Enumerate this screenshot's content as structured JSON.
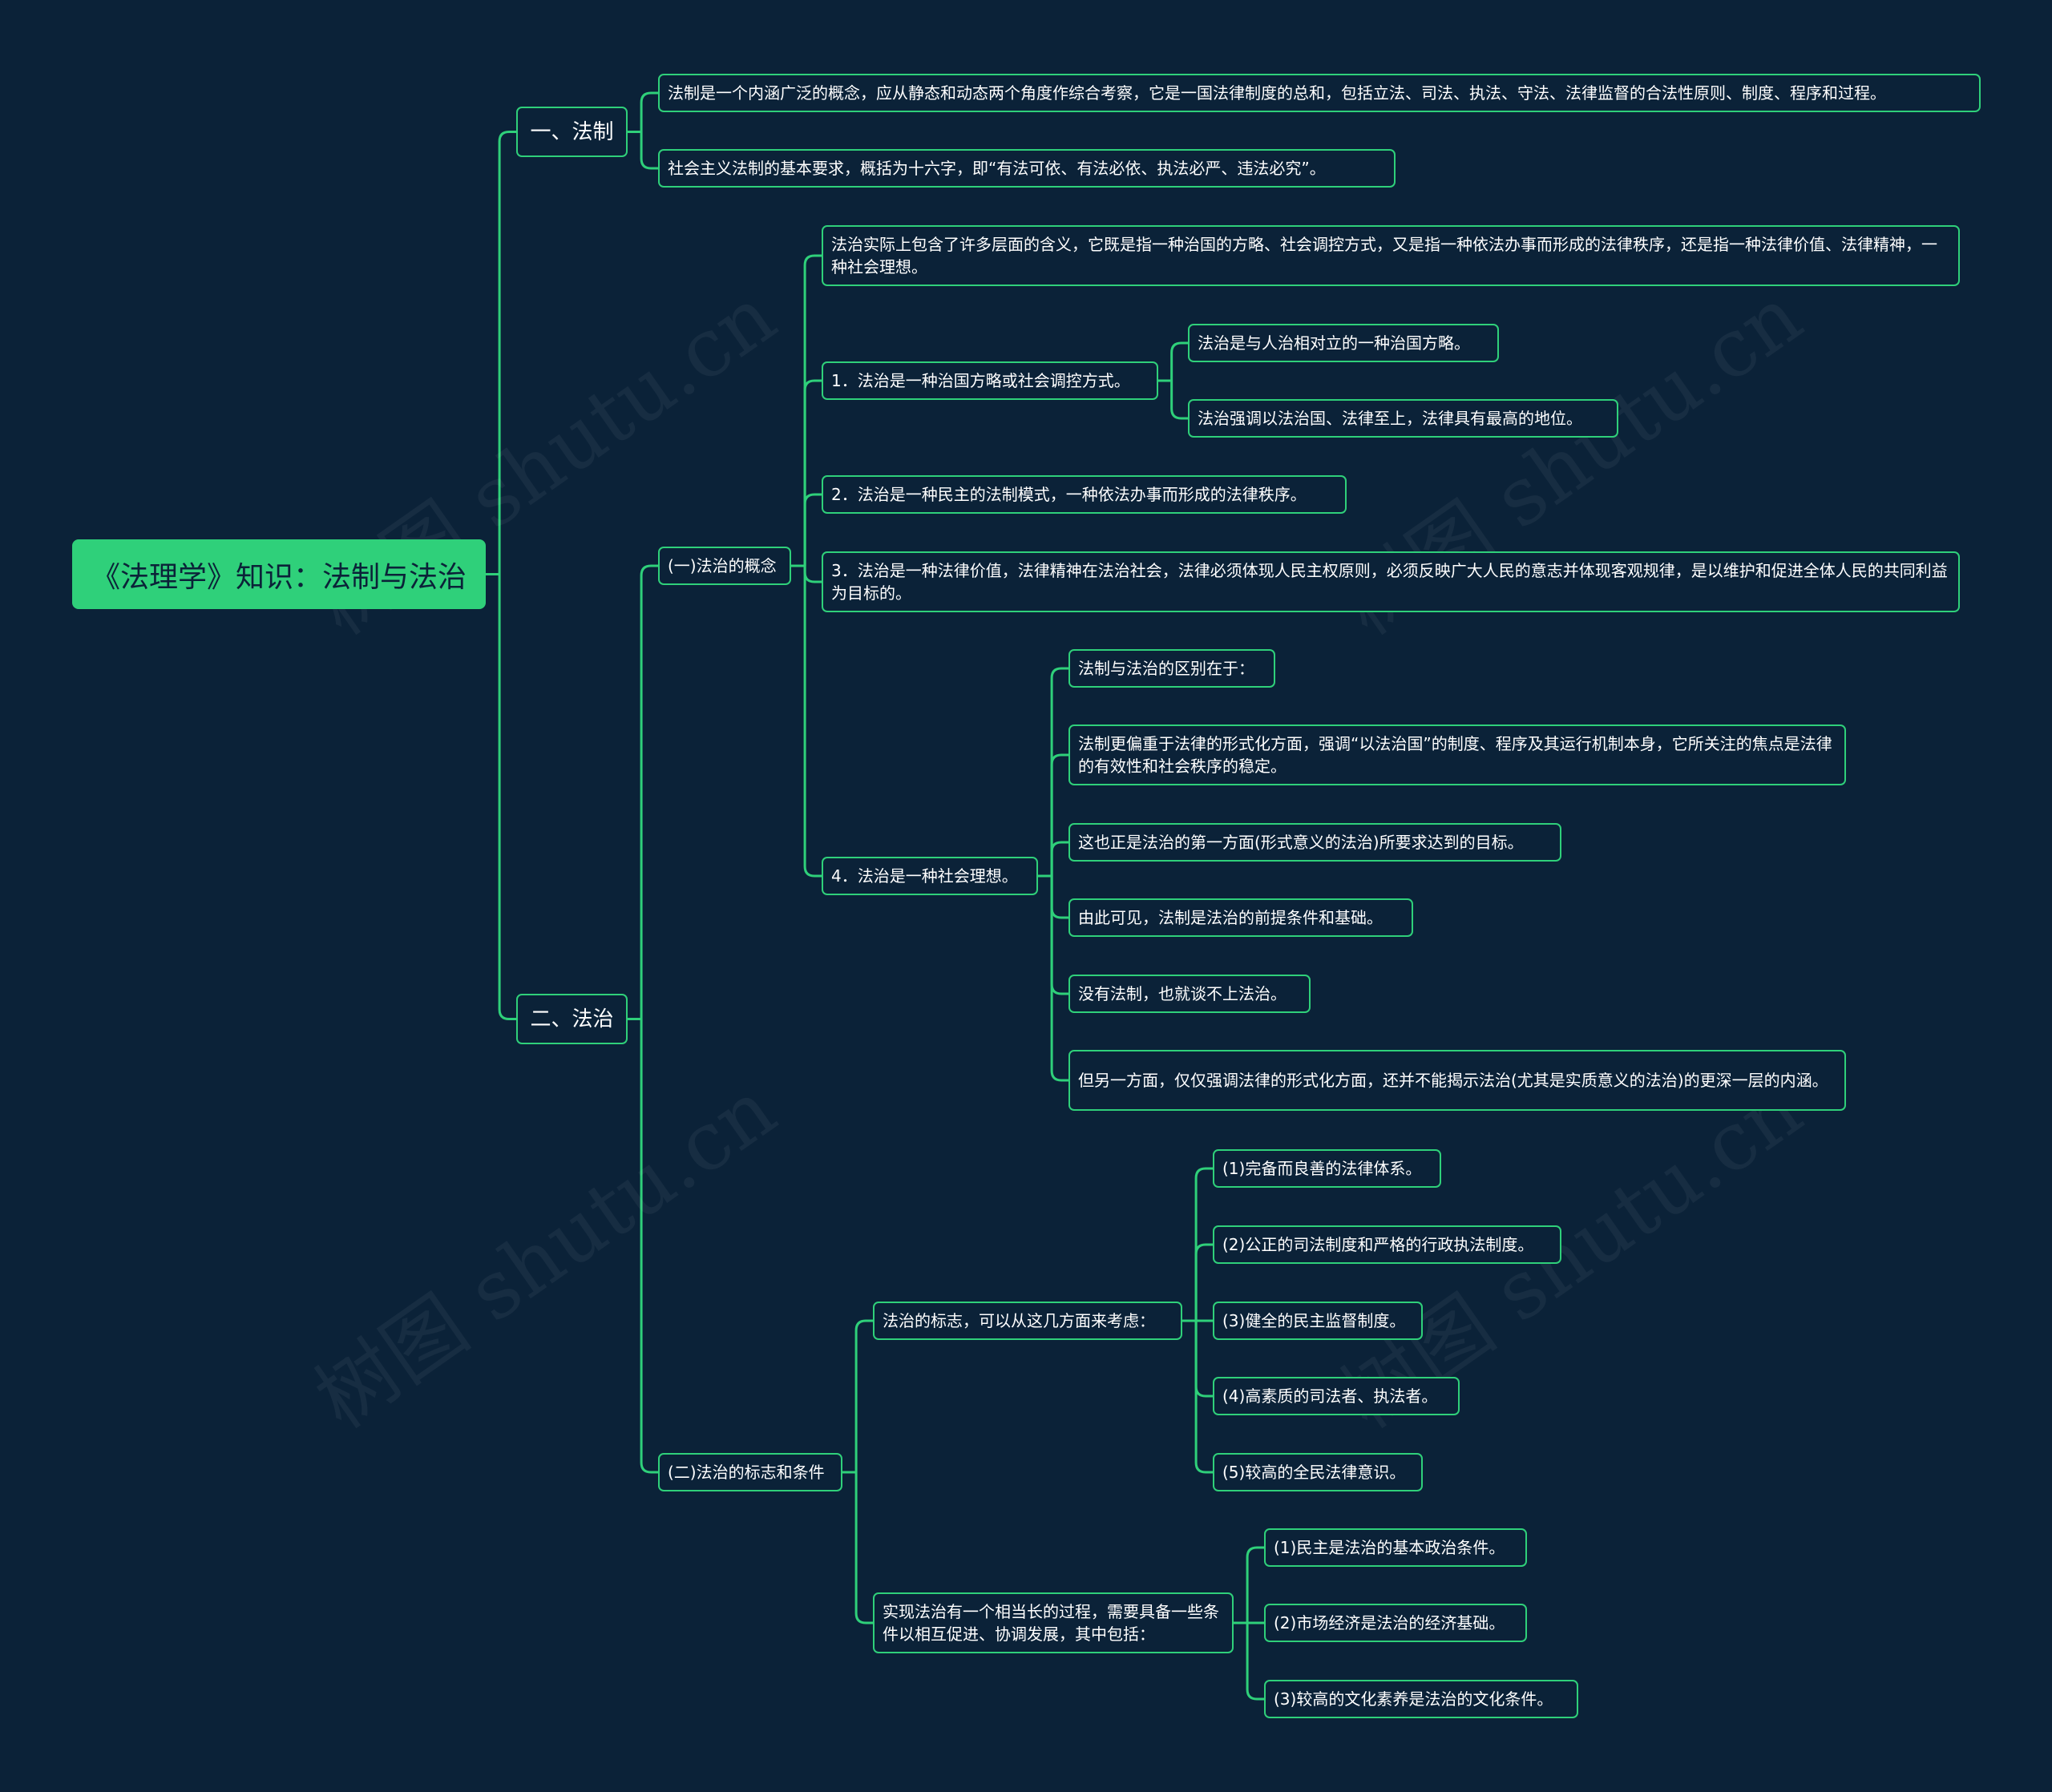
{
  "diagram": {
    "root": "《法理学》知识：法制与法治",
    "watermark": "树图 shutu.cn",
    "sec1": {
      "label": "一、法制",
      "items": [
        "法制是一个内涵广泛的概念，应从静态和动态两个角度作综合考察，它是一国法律制度的总和，包括立法、司法、执法、守法、法律监督的合法性原则、制度、程序和过程。",
        "社会主义法制的基本要求，概括为十六字，即“有法可依、有法必依、执法必严、违法必究”。"
      ]
    },
    "sec2": {
      "label": "二、法治",
      "concept": {
        "label": "(一)法治的概念",
        "intro": "法治实际上包含了许多层面的含义，它既是指一种治国的方略、社会调控方式，又是指一种依法办事而形成的法律秩序，还是指一种法律价值、法律精神，一种社会理想。",
        "p1": {
          "label": "1．法治是一种治国方略或社会调控方式。",
          "items": [
            "法治是与人治相对立的一种治国方略。",
            "法治强调以法治国、法律至上，法律具有最高的地位。"
          ]
        },
        "p2": "2．法治是一种民主的法制模式，一种依法办事而形成的法律秩序。",
        "p3": "3．法治是一种法律价值，法律精神在法治社会，法律必须体现人民主权原则，必须反映广大人民的意志并体现客观规律，是以维护和促进全体人民的共同利益为目标的。",
        "p4": {
          "label": "4．法治是一种社会理想。",
          "items": [
            "法制与法治的区别在于：",
            "法制更偏重于法律的形式化方面，强调“以法治国”的制度、程序及其运行机制本身，它所关注的焦点是法律的有效性和社会秩序的稳定。",
            "这也正是法治的第一方面(形式意义的法治)所要求达到的目标。",
            "由此可见，法制是法治的前提条件和基础。",
            "没有法制，也就谈不上法治。",
            "但另一方面，仅仅强调法律的形式化方面，还并不能揭示法治(尤其是实质意义的法治)的更深一层的内涵。"
          ]
        }
      },
      "marks": {
        "label": "(二)法治的标志和条件",
        "signs": {
          "label": "法治的标志，可以从这几方面来考虑：",
          "items": [
            "(1)完备而良善的法律体系。",
            "(2)公正的司法制度和严格的行政执法制度。",
            "(3)健全的民主监督制度。",
            "(4)高素质的司法者、执法者。",
            "(5)较高的全民法律意识。"
          ]
        },
        "conditions": {
          "label": "实现法治有一个相当长的过程，需要具备一些条件以相互促进、协调发展，其中包括：",
          "items": [
            "(1)民主是法治的基本政治条件。",
            "(2)市场经济是法治的经济基础。",
            "(3)较高的文化素养是法治的文化条件。"
          ]
        }
      }
    }
  },
  "colors": {
    "background": "#0b2238",
    "accent": "#2fd07a",
    "text": "#ffffff"
  }
}
